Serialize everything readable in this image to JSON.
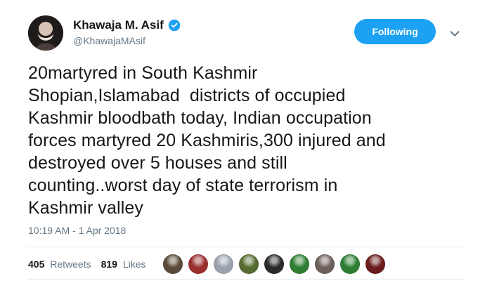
{
  "tweet": {
    "display_name": "Khawaja M. Asif",
    "handle": "@KhawajaMAsif",
    "follow_button": "Following",
    "text": "20martyred in South Kashmir\nShopian,Islamabad  districts of occupied\nKashmir bloodbath today, Indian occupation\nforces martyred 20 Kashmiris,300 injured and\ndestroyed over 5 houses and still\ncounting..worst day of state terrorism in\nKashmir valley",
    "timestamp": "10:19 AM - 1 Apr 2018",
    "retweets_count": "405",
    "retweets_label": "Retweets",
    "likes_count": "819",
    "likes_label": "Likes",
    "icons": {
      "verified": "verified-badge-icon",
      "caret": "chevron-down-icon"
    },
    "colors": {
      "accent": "#1da1f2",
      "text": "#14171a",
      "muted": "#657786",
      "divider": "#e6ecf0"
    },
    "likers": [
      {
        "name": "liker-1",
        "color": "#5a4a3a"
      },
      {
        "name": "liker-2",
        "color": "#9b2f2f"
      },
      {
        "name": "liker-3",
        "color": "#9aa3ad"
      },
      {
        "name": "liker-4",
        "color": "#556b2f"
      },
      {
        "name": "liker-5",
        "color": "#2b2b2b"
      },
      {
        "name": "liker-6",
        "color": "#2f7d32"
      },
      {
        "name": "liker-7",
        "color": "#6d5f5a"
      },
      {
        "name": "liker-8",
        "color": "#2e7d32"
      },
      {
        "name": "liker-9",
        "color": "#6a1b1b"
      }
    ]
  }
}
